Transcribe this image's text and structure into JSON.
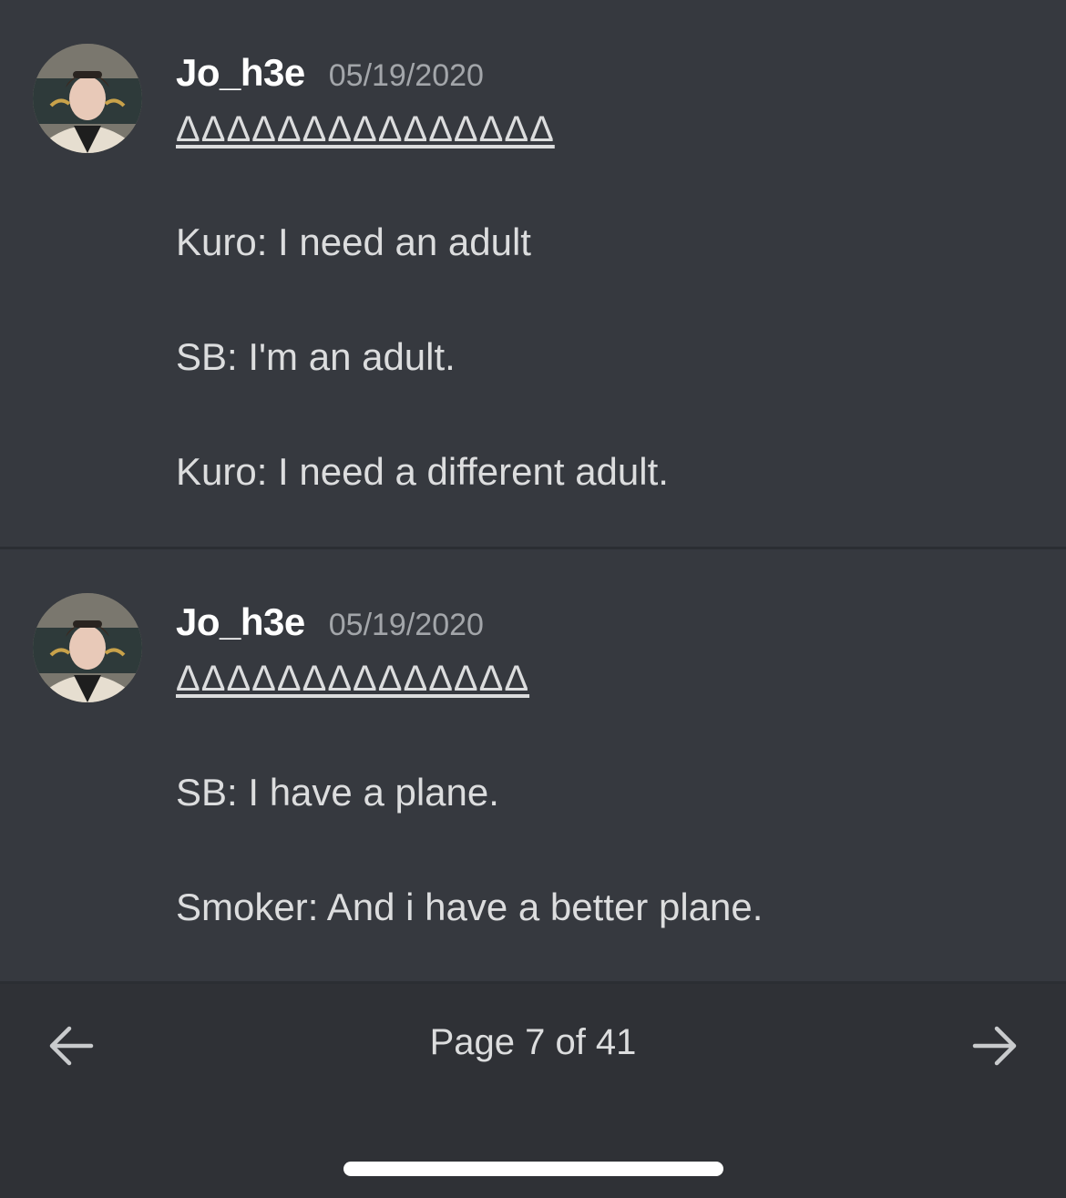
{
  "messages": [
    {
      "username": "Jo_h3e",
      "timestamp": "05/19/2020",
      "avatar": "profile-avatar",
      "deltas": "ΔΔΔΔΔΔΔΔΔΔΔΔΔΔΔ",
      "lines": [
        "Kuro: I need an adult",
        "SB: I'm an adult.",
        "Kuro: I need a different adult."
      ]
    },
    {
      "username": "Jo_h3e",
      "timestamp": "05/19/2020",
      "avatar": "profile-avatar",
      "deltas": "ΔΔΔΔΔΔΔΔΔΔΔΔΔΔ",
      "lines": [
        "SB: I have a plane.",
        "Smoker: And i have a better plane."
      ]
    }
  ],
  "pagination": {
    "label": "Page 7 of 41",
    "prev_icon": "arrow-left-icon",
    "next_icon": "arrow-right-icon"
  },
  "colors": {
    "background": "#36393f",
    "bottom_bar": "#2f3136",
    "username": "#ffffff",
    "timestamp": "#a3a6aa",
    "text": "#dcddde"
  }
}
